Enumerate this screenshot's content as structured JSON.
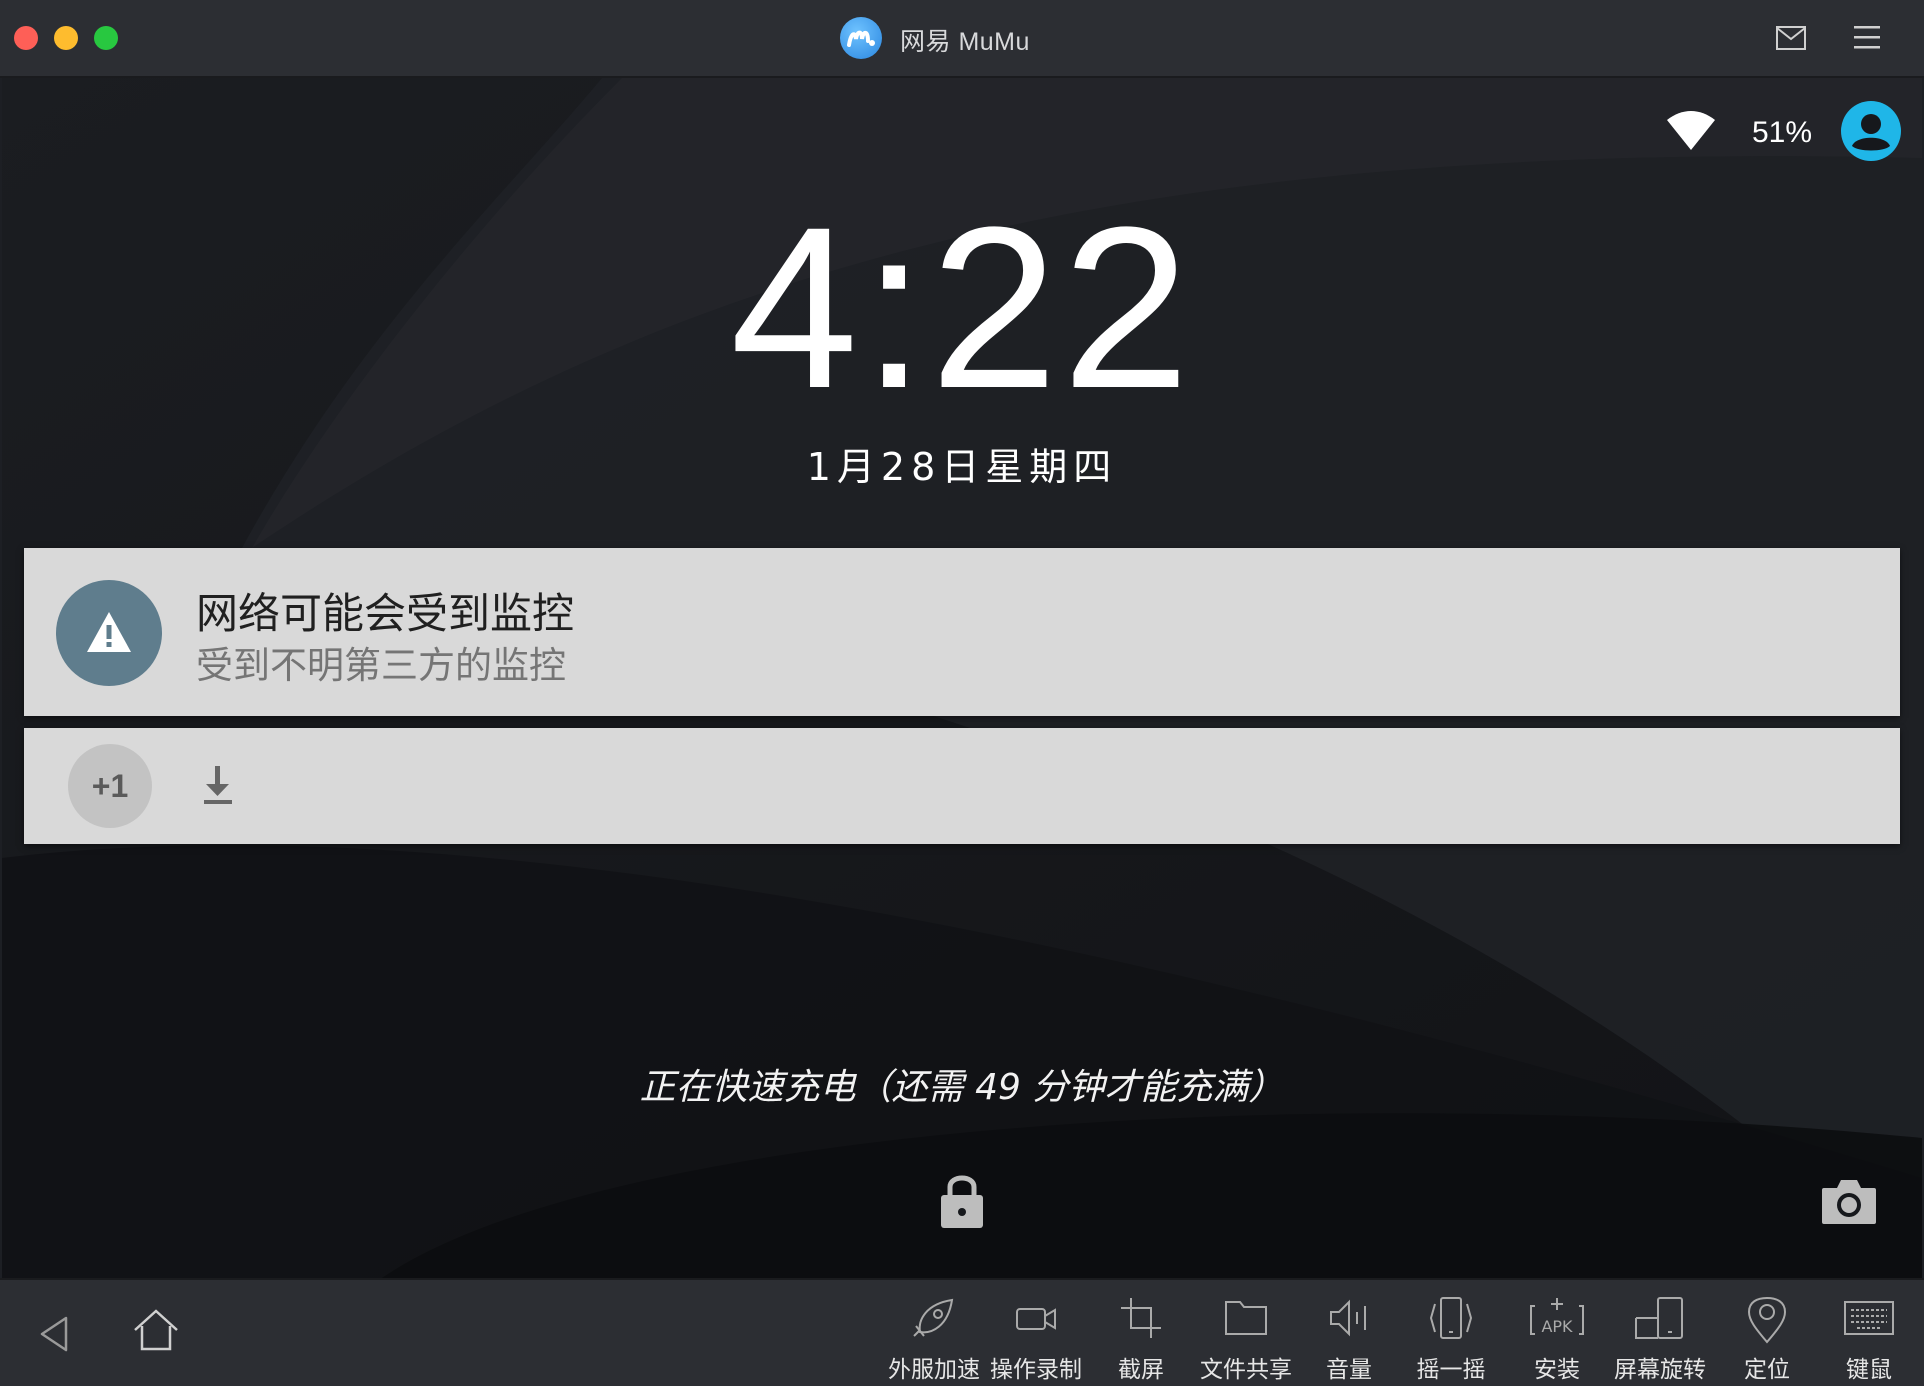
{
  "titlebar": {
    "app_title": "网易 MuMu",
    "icons": [
      "mumu-logo-icon",
      "mail-icon",
      "menu-icon"
    ]
  },
  "status_bar": {
    "battery": "51%",
    "icons": [
      "wifi-icon",
      "user-icon"
    ]
  },
  "lockscreen": {
    "time": "4:22",
    "date": "1月28日星期四",
    "charging": "正在快速充电（还需 49 分钟才能充满）"
  },
  "notifications": [
    {
      "title": "网络可能会受到监控",
      "text": "受到不明第三方的监控",
      "icon": "warning-icon"
    },
    {
      "badge": "+1",
      "icon": "download-icon"
    }
  ],
  "toolbar": {
    "nav": [
      "back-icon",
      "home-icon"
    ],
    "tools": [
      {
        "label": "外服加速",
        "icon": "rocket-icon"
      },
      {
        "label": "操作录制",
        "icon": "video-camera-icon"
      },
      {
        "label": "截屏",
        "icon": "crop-icon"
      },
      {
        "label": "文件共享",
        "icon": "folder-icon"
      },
      {
        "label": "音量",
        "icon": "speaker-icon"
      },
      {
        "label": "摇一摇",
        "icon": "shake-phone-icon"
      },
      {
        "label": "安装",
        "icon": "apk-icon"
      },
      {
        "label": "屏幕旋转",
        "icon": "rotate-screen-icon"
      },
      {
        "label": "定位",
        "icon": "location-pin-icon"
      },
      {
        "label": "键鼠",
        "icon": "keyboard-icon"
      }
    ]
  },
  "colors": {
    "titlebar_bg": "#2c2e33",
    "screen_bg": "#16181c",
    "notification_bg": "#d9d9d9",
    "warning_circle": "#5f7d8d",
    "accent_user": "#1fb6e8"
  }
}
